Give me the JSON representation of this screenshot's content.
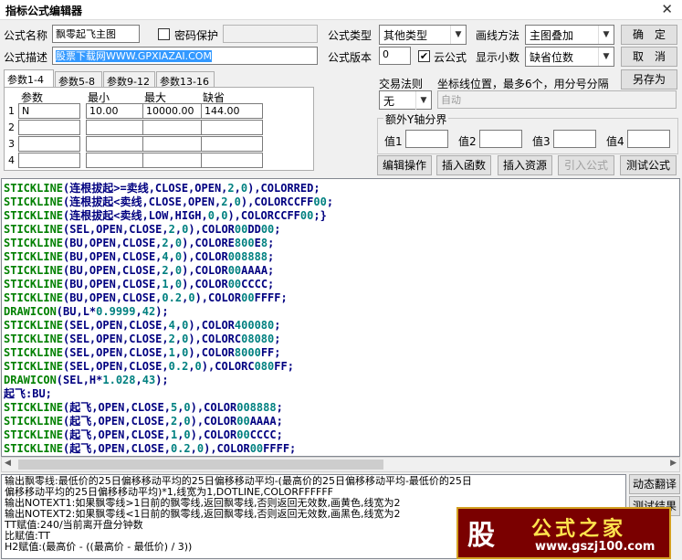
{
  "window": {
    "title": "指标公式编辑器",
    "close": "✕"
  },
  "form": {
    "name_label": "公式名称",
    "name_value": "飘零起飞主图",
    "password_label": "密码保护",
    "password_checked": false,
    "desc_label": "公式描述",
    "desc_value": "股票下载网WWW.GPXIAZAI.COM",
    "type_label": "公式类型",
    "type_value": "其他类型",
    "draw_label": "画线方法",
    "draw_value": "主图叠加",
    "version_label": "公式版本",
    "version_value": "0",
    "cloud_label": "云公式",
    "cloud_checked": true,
    "decimal_label": "显示小数",
    "decimal_value": "缺省位数"
  },
  "buttons": {
    "ok": "确　定",
    "cancel": "取　消",
    "save_as": "另存为",
    "edit_op": "编辑操作",
    "insert_func": "插入函数",
    "insert_res": "插入资源",
    "import_formula": "引入公式",
    "test_formula": "测试公式",
    "auto_translate": "动态翻译",
    "test_result": "测试结果"
  },
  "tabs": [
    "参数1-4",
    "参数5-8",
    "参数9-12",
    "参数13-16"
  ],
  "params": {
    "headers": [
      "参数",
      "最小",
      "最大",
      "缺省"
    ],
    "rows": [
      {
        "n": "1",
        "name": "N",
        "min": "10.00",
        "max": "10000.00",
        "def": "144.00"
      },
      {
        "n": "2",
        "name": "",
        "min": "",
        "max": "",
        "def": ""
      },
      {
        "n": "3",
        "name": "",
        "min": "",
        "max": "",
        "def": ""
      },
      {
        "n": "4",
        "name": "",
        "min": "",
        "max": "",
        "def": ""
      }
    ]
  },
  "trade": {
    "rule_label": "交易法则",
    "rule_value": "无",
    "coord_label": "坐标线位置，最多6个，用分号分隔",
    "coord_placeholder": "自动"
  },
  "yaxis": {
    "title": "额外Y轴分界",
    "labels": [
      "值1",
      "值2",
      "值3",
      "值4"
    ]
  },
  "code_lines": [
    "STICKLINE(连根拔起>=卖线,CLOSE,OPEN,2,0),COLORRED;",
    "STICKLINE(连根拔起<卖线,CLOSE,OPEN,2,0),COLORCCFF00;",
    "STICKLINE(连根拔起<卖线,LOW,HIGH,0,0),COLORCCFF00;}",
    "STICKLINE(SEL,OPEN,CLOSE,2,0),COLOR00DD00;",
    "STICKLINE(BU,OPEN,CLOSE,2,0),COLORE800E8;",
    "STICKLINE(BU,OPEN,CLOSE,4,0),COLOR008888;",
    "STICKLINE(BU,OPEN,CLOSE,2,0),COLOR00AAAA;",
    "STICKLINE(BU,OPEN,CLOSE,1,0),COLOR00CCCC;",
    "STICKLINE(BU,OPEN,CLOSE,0.2,0),COLOR00FFFF;",
    "DRAWICON(BU,L*0.9999,42);",
    "STICKLINE(SEL,OPEN,CLOSE,4,0),COLOR400080;",
    "STICKLINE(SEL,OPEN,CLOSE,2,0),COLORC08080;",
    "STICKLINE(SEL,OPEN,CLOSE,1,0),COLOR8000FF;",
    "STICKLINE(SEL,OPEN,CLOSE,0.2,0),COLORC080FF;",
    "DRAWICON(SEL,H*1.028,43);",
    "起飞:BU;",
    "STICKLINE(起飞,OPEN,CLOSE,5,0),COLOR008888;",
    "STICKLINE(起飞,OPEN,CLOSE,2,0),COLOR00AAAA;",
    "STICKLINE(起飞,OPEN,CLOSE,1,0),COLOR00CCCC;",
    "STICKLINE(起飞,OPEN,CLOSE,0.2,0),COLOR00FFFF;"
  ],
  "output_lines": [
    "输出飘零线:最低价的25日偏移移动平均的25日偏移移动平均-(最高价的25日偏移移动平均-最低价的25日",
    "偏移移动平均的25日偏移移动平均)*1,线宽为1,DOTLINE,COLORFFFFFF",
    "输出NOTEXT1:如果飘零线>1日前的飘零线,返回飘零线,否则返回无效数,画黄色,线宽为2",
    "输出NOTEXT2:如果飘零线<1日前的飘零线,返回飘零线,否则返回无效数,画黑色,线宽为2",
    "TT赋值:240/当前离开盘分钟数",
    "比赋值:TT",
    "H2赋值:(最高价 - ((最高价 - 最低价) / 3))"
  ],
  "logo": {
    "mark": "股",
    "name": "公式之家",
    "url": "www.gszj100.com"
  }
}
